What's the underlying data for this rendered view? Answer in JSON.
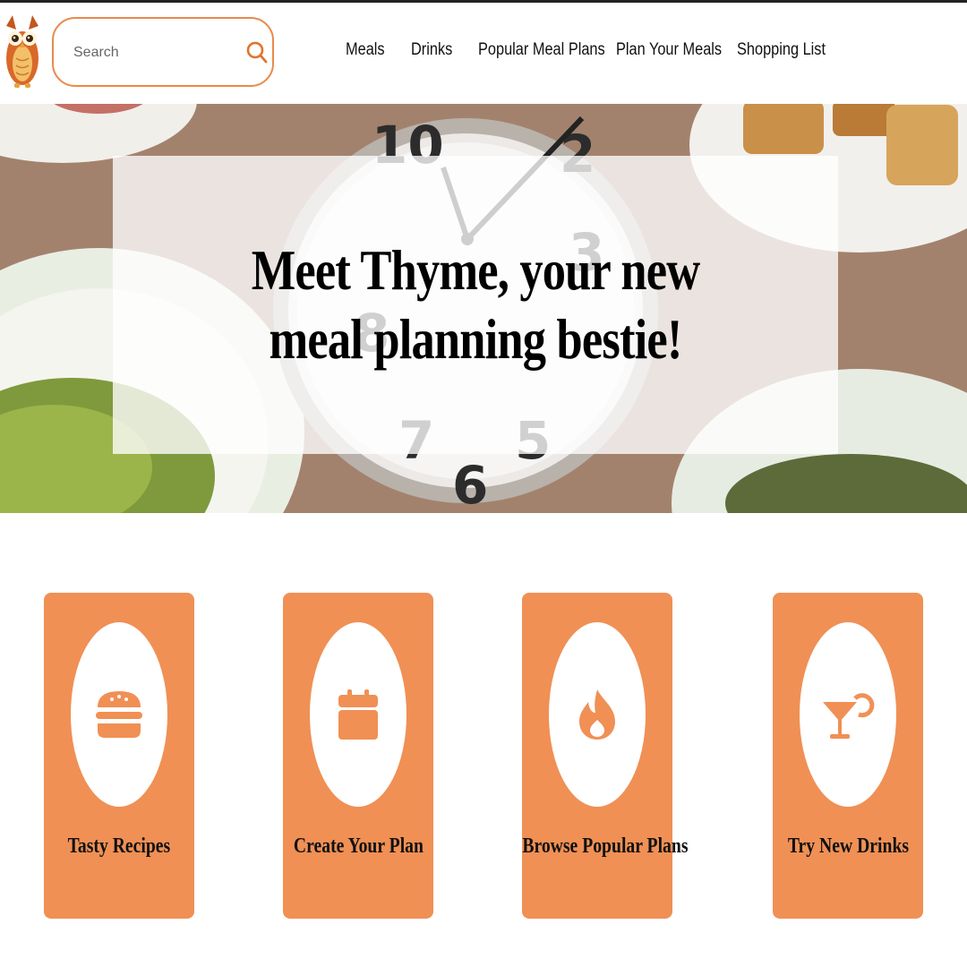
{
  "header": {
    "search": {
      "placeholder": "Search",
      "value": "",
      "icon": "search-icon"
    },
    "nav": [
      {
        "label": "Meals"
      },
      {
        "label": "Drinks"
      },
      {
        "label": "Popular Meal Plans"
      },
      {
        "label": "Plan Your Meals"
      },
      {
        "label": "Shopping List"
      }
    ]
  },
  "hero": {
    "title": "Meet Thyme, your new meal planning bestie!"
  },
  "cards": [
    {
      "label": "Tasty Recipes",
      "icon": "burger-icon"
    },
    {
      "label": "Create Your Plan",
      "icon": "calendar-icon"
    },
    {
      "label": "Browse Popular Plans",
      "icon": "fire-icon"
    },
    {
      "label": "Try New Drinks",
      "icon": "cocktail-icon"
    }
  ],
  "colors": {
    "accent": "#f09055",
    "search_border": "#e98a4a",
    "text": "#111111",
    "background": "#ffffff"
  }
}
